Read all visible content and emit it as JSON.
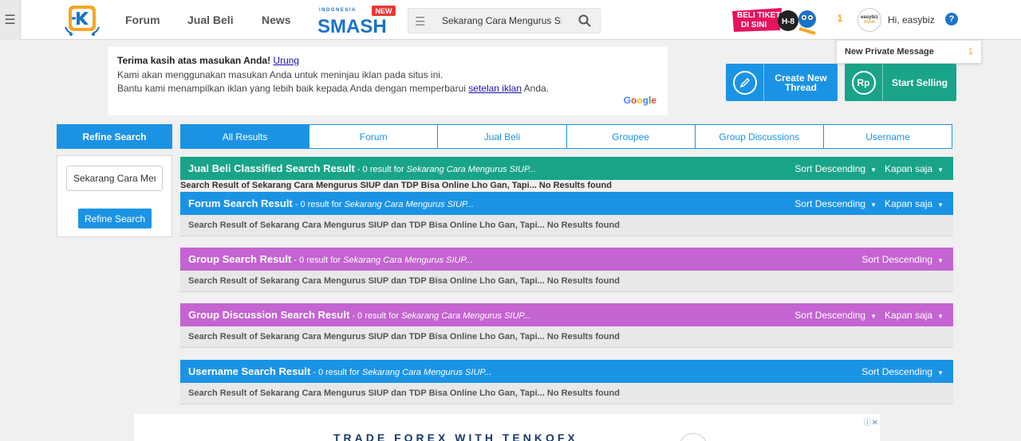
{
  "nav": {
    "links": [
      "Forum",
      "Jual Beli",
      "News"
    ],
    "smash_brand": "SMASH",
    "smash_tag": "INDONESIA",
    "smash_badge": "NEW",
    "search_value": "Sekarang Cara Mengurus SIUP",
    "promo_line1": "BELI TIKET",
    "promo_line2": "DI SINI",
    "promo_badge": "H-8",
    "notif_count": "1",
    "avatar_brand": "easybiz",
    "avatar_sub": "Bizlab",
    "greeting": "Hi, easybiz",
    "help_glyph": "?"
  },
  "pm": {
    "label": "New Private Message",
    "count": "1"
  },
  "ad_feedback": {
    "title": "Terima kasih atas masukan Anda!",
    "undo": "Urung",
    "line1": "Kami akan menggunakan masukan Anda untuk meninjau iklan pada situs ini.",
    "line2_pre": "Bantu kami menampilkan iklan yang lebih baik kepada Anda dengan memperbarui ",
    "line2_link": "setelan iklan",
    "line2_post": " Anda.",
    "google": "Google"
  },
  "actions": {
    "create_line1": "Create New",
    "create_line2": "Thread",
    "sell_label": "Start Selling",
    "sell_icon_text": "Rp"
  },
  "sidebar": {
    "header": "Refine Search",
    "input_value": "Sekarang Cara Mengurus SIUP",
    "button": "Refine Search"
  },
  "tabs": [
    "All Results",
    "Forum",
    "Jual Beli",
    "Groupee",
    "Group Discussions",
    "Username"
  ],
  "sections": [
    {
      "title": "Jual Beli Classified Search Result",
      "count_text": " - 0 result for ",
      "query": "Sekarang Cara Mengurus SIUP...",
      "sort": "Sort Descending",
      "time": "Kapan saja",
      "body": "Search Result of Sekarang Cara Mengurus SIUP dan TDP Bisa Online Lho Gan, Tapi... No Results found"
    },
    {
      "title": "Forum Search Result",
      "count_text": " - 0 result for ",
      "query": "Sekarang Cara Mengurus SIUP...",
      "sort": "Sort Descending",
      "time": "Kapan saja",
      "body": "Search Result of Sekarang Cara Mengurus SIUP dan TDP Bisa Online Lho Gan, Tapi... No Results found"
    },
    {
      "title": "Group Search Result",
      "count_text": " - 0 result for ",
      "query": "Sekarang Cara Mengurus SIUP...",
      "sort": "Sort Descending",
      "time": "",
      "body": "Search Result of Sekarang Cara Mengurus SIUP dan TDP Bisa Online Lho Gan, Tapi... No Results found"
    },
    {
      "title": "Group Discussion Search Result",
      "count_text": " - 0 result for ",
      "query": "Sekarang Cara Mengurus SIUP...",
      "sort": "Sort Descending",
      "time": "Kapan saja",
      "body": "Search Result of Sekarang Cara Mengurus SIUP dan TDP Bisa Online Lho Gan, Tapi... No Results found"
    },
    {
      "title": "Username Search Result",
      "count_text": " - 0 result for ",
      "query": "Sekarang Cara Mengurus SIUP...",
      "sort": "Sort Descending",
      "time": "",
      "body": "Search Result of Sekarang Cara Mengurus SIUP dan TDP Bisa Online Lho Gan, Tapi... No Results found"
    }
  ],
  "ad_bottom": {
    "text": "TRADE FOREX WITH TENKOFX"
  },
  "colors": {
    "primary_blue": "#1b93e4",
    "teal": "#19a489",
    "purple": "#c463d2",
    "badge_orange": "#f5a623"
  }
}
